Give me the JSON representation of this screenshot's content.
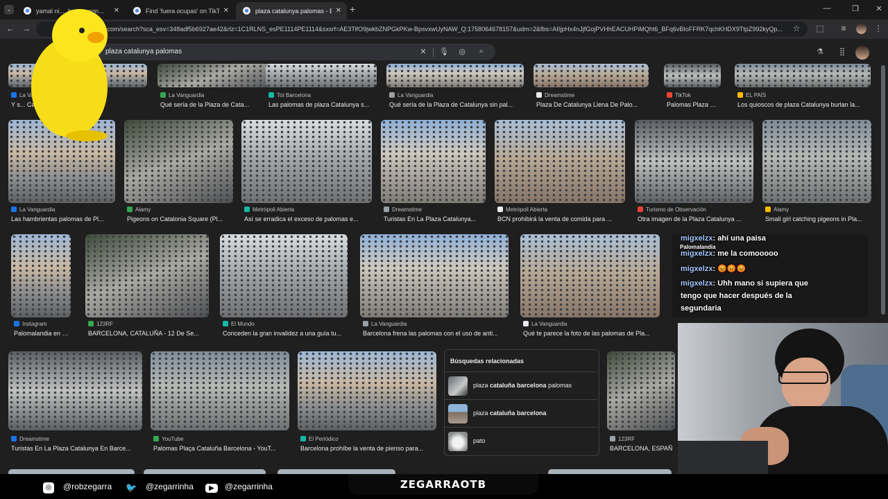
{
  "browser": {
    "tabs": [
      {
        "title": "yamal ni..._buscar con..."
      },
      {
        "title": "Find 'fuera ocupas' on TikTok |"
      },
      {
        "title": "plaza catalunya palomas - Busc"
      }
    ],
    "address": "e.com/search?sca_esv=348adf5b6927ae42&rlz=1C1RLNS_esPE1114PE1114&sxsrf=AE3TifO9jwkbZNPGkPKw-BpsvxwUyNAW_Q:1758064678157&udm=2&fbs=AIIjpHx4nJjfGojPVHhEACUHPiMQht6_BFq6vBIoFFRK7qchKHDX9TtpZ992kyQp..."
  },
  "search": {
    "query": "plaza catalunya palomas"
  },
  "results": {
    "row1": [
      {
        "source": "La Vanguardia",
        "caption": "Y s... Catalun..."
      },
      {
        "source": "La Vanguardia",
        "caption": "Qué sería de la Plaza de Cata..."
      },
      {
        "source": "Tot Barcelona",
        "caption": "Las palomas de plaza Catalunya s..."
      },
      {
        "source": "La Vanguardia",
        "caption": "Qué sería de la Plaza de Catalunya sin pal..."
      },
      {
        "source": "Dreamstime",
        "caption": "Plaza De Catalunya Llena De Palo..."
      },
      {
        "source": "TikTok",
        "caption": "Palomas Plaza Cat..."
      },
      {
        "source": "EL PAÍS",
        "caption": "Los quioscos de plaza Catalunya burlan la..."
      }
    ],
    "row2": [
      {
        "source": "La Vanguardia",
        "caption": "Las hambrientas palomas de Pl..."
      },
      {
        "source": "Alamy",
        "caption": "Pigeons on Catalonia Square (Pl..."
      },
      {
        "source": "Metròpoli Abierta",
        "caption": "Así se erradica el exceso de palomas e..."
      },
      {
        "source": "Dreamstime",
        "caption": "Turistas En La Plaza Catalunya..."
      },
      {
        "source": "Metròpoli Abierta",
        "caption": "BCN prohibirá la venta de comida para ..."
      },
      {
        "source": "Turismo de Observación",
        "caption": "Otra imagen de la Plaza Catalunya ..."
      },
      {
        "source": "Alamy",
        "caption": "Small girl catching pigeons in Pla..."
      }
    ],
    "row3": [
      {
        "source": "Instagram",
        "caption": "Palomalandia en B..."
      },
      {
        "source": "123RF",
        "caption": "BARCELONA, CATALUÑA - 12 De Se..."
      },
      {
        "source": "El Mundo",
        "caption": "Conceden la gran invalidez a una guía tu..."
      },
      {
        "source": "La Vanguardia",
        "caption": "Barcelona frena las palomas con el uso de anti..."
      },
      {
        "source": "La Vanguardia",
        "caption": "Qué te parece la foto de las palomas de Pla..."
      }
    ],
    "row4": [
      {
        "source": "Dreamstime",
        "caption": "Turistas En La Plaza Catalunya En Barce..."
      },
      {
        "source": "YouTube",
        "caption": "Palomas Plaça Cataluña Barcelona - YouT..."
      },
      {
        "source": "El Periódico",
        "caption": "Barcelona prohíbe la venta de pienso para..."
      },
      {
        "source": "123RF",
        "caption": "BARCELONA, ESPAÑ"
      }
    ]
  },
  "related": {
    "heading": "Búsquedas relacionadas",
    "items": [
      {
        "pre": "plaza ",
        "bold": "cataluña barcelona",
        "post": " palomas"
      },
      {
        "pre": "plaza ",
        "bold": "cataluña barcelona",
        "post": ""
      },
      {
        "pre": "pato",
        "bold": "",
        "post": ""
      }
    ]
  },
  "chat": {
    "overlay_tag": "Palomalandia",
    "lines": [
      {
        "user": "migxelzx",
        "text": ": ahí una paisa"
      },
      {
        "user": "migxelzx",
        "text": ": me la comooooo"
      },
      {
        "user": "migxelzx",
        "text": ": 😡😡😡"
      },
      {
        "user": "migxelzx",
        "text": ": Uhh mano si supiera que"
      },
      {
        "user": "",
        "text": "tengo que hacer después de la"
      },
      {
        "user": "",
        "text": "segundaria"
      }
    ]
  },
  "stream": {
    "title": "ZEGARRAOTB",
    "instagram": "@robzegarra",
    "twitter": "@zegarrinha",
    "youtube": "@zegarrinha"
  },
  "colors": {
    "accent": "#8ab4f8",
    "page_bg": "#1f1f1f"
  }
}
